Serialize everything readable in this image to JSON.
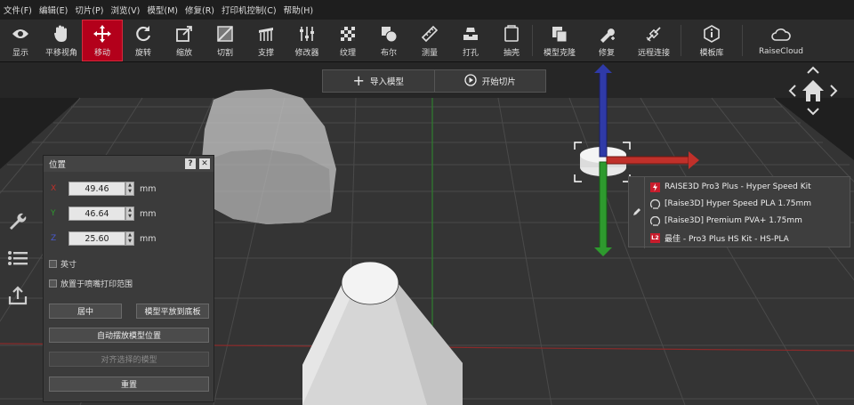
{
  "menu": [
    "文件(F)",
    "编辑(E)",
    "切片(P)",
    "浏览(V)",
    "模型(M)",
    "修复(R)",
    "打印机控制(C)",
    "帮助(H)"
  ],
  "toolbar": [
    {
      "label": "显示",
      "icon": "eye-icon"
    },
    {
      "label": "平移视角",
      "icon": "hand-icon"
    },
    {
      "label": "移动",
      "icon": "move-icon",
      "active": true
    },
    {
      "label": "旋转",
      "icon": "rotate-icon"
    },
    {
      "label": "缩放",
      "icon": "scale-icon"
    },
    {
      "label": "切割",
      "icon": "cut-icon"
    },
    {
      "label": "支撑",
      "icon": "support-icon"
    },
    {
      "label": "修改器",
      "icon": "modifier-icon"
    },
    {
      "label": "纹理",
      "icon": "texture-icon"
    },
    {
      "label": "布尔",
      "icon": "boolean-icon"
    },
    {
      "label": "测量",
      "icon": "ruler-icon"
    },
    {
      "label": "打孔",
      "icon": "punch-icon"
    },
    {
      "label": "抽壳",
      "icon": "shell-icon"
    },
    {
      "label": "模型克隆",
      "icon": "clone-icon"
    },
    {
      "label": "修复",
      "icon": "repair-icon"
    },
    {
      "label": "远程连接",
      "icon": "remote-icon"
    },
    {
      "label": "模板库",
      "icon": "template-icon"
    },
    {
      "label": "RaiseCloud",
      "icon": "cloud-icon"
    }
  ],
  "actions": {
    "import": "导入模型",
    "slice": "开始切片"
  },
  "panel": {
    "title": "位置",
    "help": "?",
    "close": "✕",
    "x_label": "X",
    "x": "49.46",
    "y_label": "Y",
    "y": "46.64",
    "z_label": "Z",
    "z": "25.60",
    "unit": "mm",
    "inch": "英寸",
    "nozzle": "放置于喷嘴打印范围",
    "center": "居中",
    "lay_flat": "模型平放到底板",
    "auto_arrange": "自动摆放模型位置",
    "align": "对齐选择的模型",
    "reset": "重置"
  },
  "profiles": [
    {
      "text": "RAISE3D Pro3 Plus - Hyper Speed Kit",
      "icon": "printer-icon"
    },
    {
      "text": "[Raise3D] Hyper Speed PLA 1.75mm",
      "icon": "filament-icon"
    },
    {
      "text": "[Raise3D] Premium PVA+ 1.75mm",
      "icon": "filament-icon"
    },
    {
      "text": "最佳 - Pro3 Plus HS Kit - HS-PLA",
      "icon": "l2-icon",
      "badge": "L2"
    }
  ],
  "colors": {
    "accent": "#b3001b",
    "x_axis": "#c0302a",
    "y_axis": "#2e9a2e",
    "z_axis": "#2f3aa8"
  }
}
